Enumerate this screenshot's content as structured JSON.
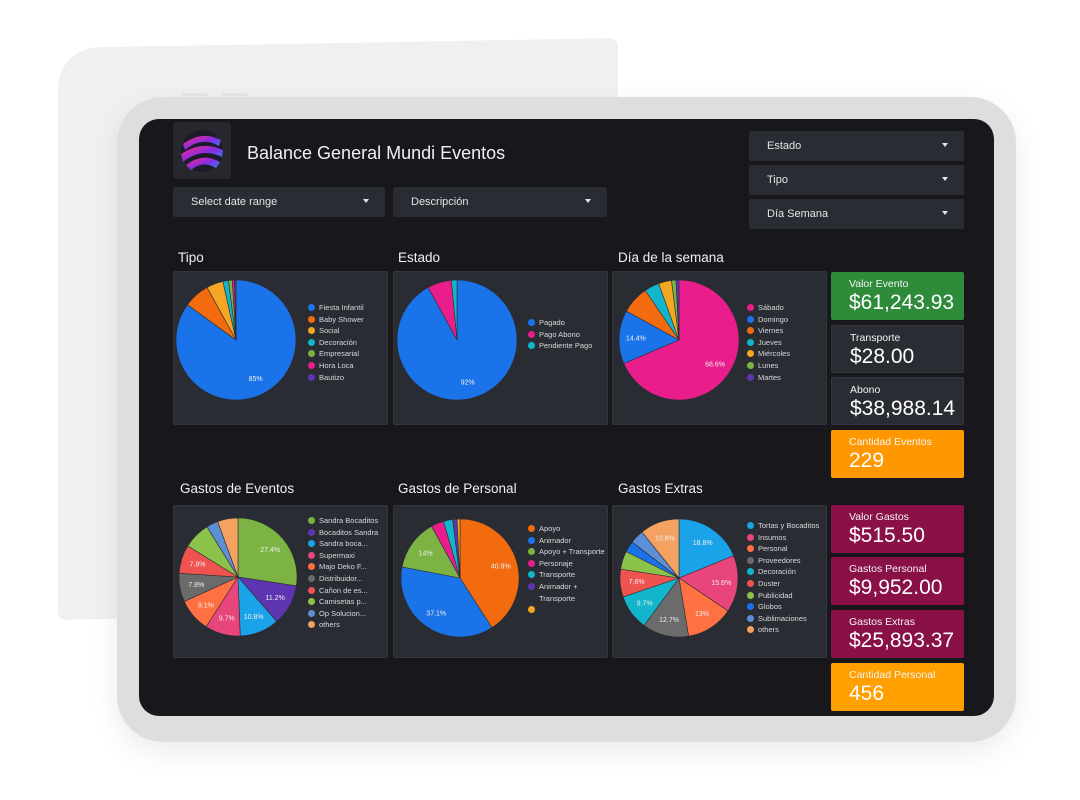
{
  "header": {
    "title": "Balance General Mundi Eventos",
    "filters": {
      "date_range": "Select date range",
      "descripcion": "Descripción",
      "estado": "Estado",
      "tipo": "Tipo",
      "dia_semana": "Día Semana"
    }
  },
  "charts": [
    {
      "title": "Tipo",
      "legend": [
        "Fiesta Infantil",
        "Baby Shower",
        "Social",
        "Decoración",
        "Empresarial",
        "Hora Loca",
        "Bautizo"
      ],
      "colors": [
        "#1a73e8",
        "#f26b0f",
        "#f5a623",
        "#12b5cb",
        "#7cb342",
        "#e91e8c",
        "#5e35b1"
      ],
      "values": [
        85,
        7,
        4.5,
        1.5,
        1,
        0.6,
        0.4
      ],
      "labels": [
        "85%",
        "",
        "",
        "",
        "",
        "",
        ""
      ]
    },
    {
      "title": "Estado",
      "legend": [
        "Pagado",
        "Pago Abono",
        "Pendiente Pago"
      ],
      "colors": [
        "#1a73e8",
        "#e91e8c",
        "#12b5cb"
      ],
      "values": [
        92,
        6.5,
        1.5
      ],
      "labels": [
        "92%",
        "",
        ""
      ]
    },
    {
      "title": "Día de la semana",
      "legend": [
        "Sábado",
        "Domingo",
        "Viernes",
        "Jueves",
        "Miércoles",
        "Lunes",
        "Martes"
      ],
      "colors": [
        "#e91e8c",
        "#1a73e8",
        "#f26b0f",
        "#12b5cb",
        "#f5a623",
        "#7cb342",
        "#5e35b1"
      ],
      "values": [
        68.6,
        14.4,
        7.5,
        4,
        3.5,
        1.2,
        0.8
      ],
      "labels": [
        "68.6%",
        "14.4%",
        "",
        "",
        "",
        "",
        ""
      ]
    },
    {
      "title": "Gastos de Eventos",
      "legend": [
        "Sandra Bocaditos",
        "Bocaditos Sandra",
        "Sandra boca...",
        "Supermaxi",
        "Majo Deko F...",
        "Distribuidor...",
        "Cañon de es...",
        "Camisetas p...",
        "Op Solucion...",
        "others"
      ],
      "colors": [
        "#7cb342",
        "#5e35b1",
        "#1aa3e8",
        "#e8457a",
        "#ff7043",
        "#6b6b6b",
        "#ef5350",
        "#8bc34a",
        "#5c8fd6",
        "#f4a261"
      ],
      "values": [
        27.4,
        11.2,
        10.8,
        9.7,
        9.1,
        7.8,
        7.8,
        7.4,
        3.2,
        5.6
      ],
      "labels": [
        "27.4%",
        "11.2%",
        "10.8%",
        "9.7%",
        "9.1%",
        "7.8%",
        "7.8%",
        "",
        "",
        ""
      ]
    },
    {
      "title": "Gastos de Personal",
      "legend": [
        "Apoyo",
        "Animador",
        "Apoyo + Transporte",
        "Personaje",
        "Transporte",
        "Animador + Transporte",
        ""
      ],
      "colors": [
        "#f26b0f",
        "#1a73e8",
        "#7cb342",
        "#e91e8c",
        "#12b5cb",
        "#5e35b1",
        "#f5a623"
      ],
      "values": [
        40.9,
        37.1,
        14,
        3.5,
        2.5,
        1.2,
        0.8
      ],
      "labels": [
        "40.9%",
        "37.1%",
        "14%",
        "",
        "",
        "",
        ""
      ]
    },
    {
      "title": "Gastos Extras",
      "legend": [
        "Tortas y Bocaditos",
        "Insumos",
        "Personal",
        "Proveedores",
        "Decoración",
        "Duster",
        "Publicidad",
        "Globos",
        "Sublimaciones",
        "others"
      ],
      "colors": [
        "#1aa3e8",
        "#e8457a",
        "#ff7043",
        "#6b6b6b",
        "#12b5cb",
        "#ef5350",
        "#8bc34a",
        "#1a73e8",
        "#5c8fd6",
        "#f4a261"
      ],
      "values": [
        18.8,
        15.6,
        13,
        12.7,
        9.7,
        7.6,
        5,
        3,
        3.8,
        10.8
      ],
      "labels": [
        "18.8%",
        "15.6%",
        "13%",
        "12.7%",
        "9.7%",
        "7.6%",
        "",
        "",
        "",
        "10.8%"
      ]
    }
  ],
  "kpis": [
    {
      "label": "Valor Evento",
      "value": "$61,243.93",
      "color": "#2e8b3a"
    },
    {
      "label": "Transporte",
      "value": "$28.00",
      "color": "#2a2c33"
    },
    {
      "label": "Abono",
      "value": "$38,988.14",
      "color": "#2a2c33"
    },
    {
      "label": "Cantidad Eventos",
      "value": "229",
      "color": "#ff9800"
    },
    {
      "label": "Valor Gastos",
      "value": "$515.50",
      "color": "#8a1048"
    },
    {
      "label": "Gastos Personal",
      "value": "$9,952.00",
      "color": "#8a1048"
    },
    {
      "label": "Gastos Extras",
      "value": "$25,893.37",
      "color": "#8a1048"
    },
    {
      "label": "Cantidad Personal",
      "value": "456",
      "color": "#ff9f00"
    }
  ]
}
